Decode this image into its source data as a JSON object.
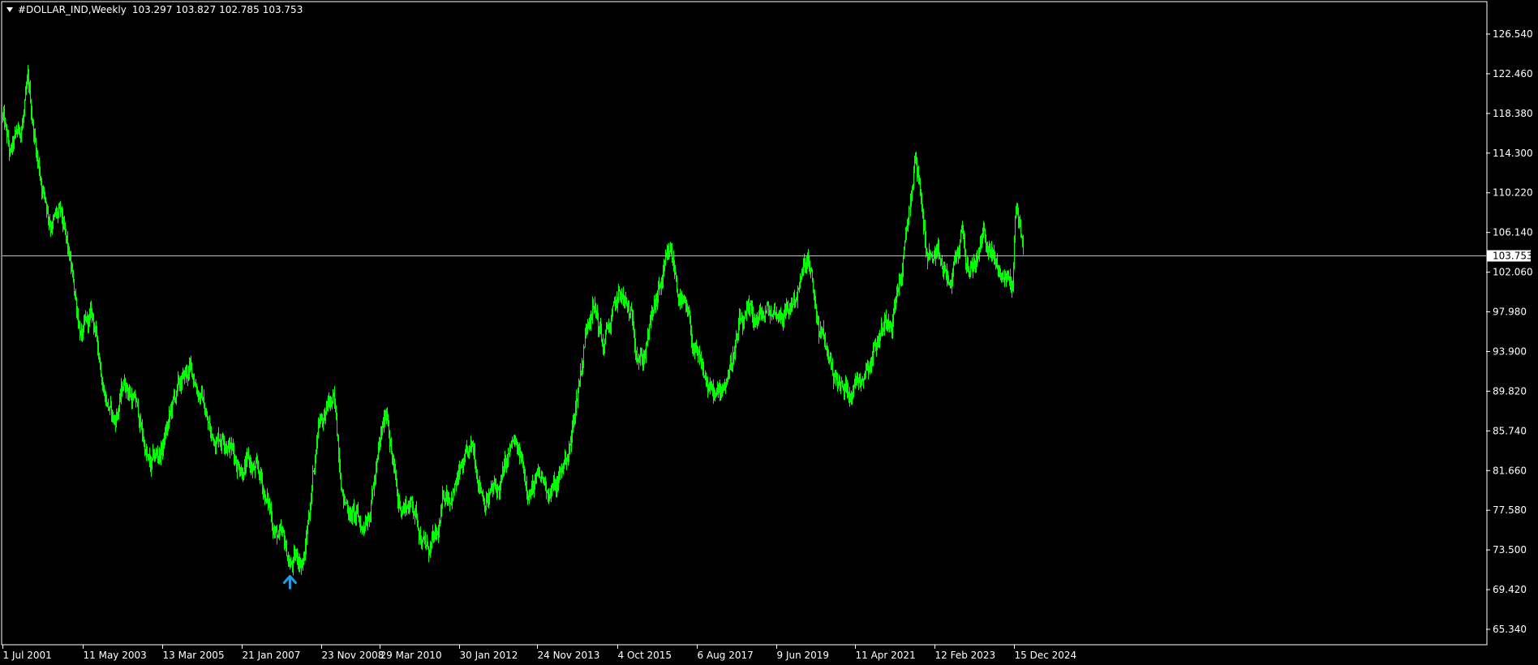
{
  "header": {
    "symbol": "#DOLLAR_IND,Weekly",
    "open": "103.297",
    "high": "103.827",
    "low": "102.785",
    "close": "103.753",
    "menu_icon": "triangle-down-icon"
  },
  "colors": {
    "background": "#000000",
    "candles": "#00ff00",
    "frame": "#ffffff",
    "axis_text": "#ffffff",
    "price_line": "#c0c0c0",
    "price_box_bg": "#ffffff",
    "price_box_text": "#000000",
    "arrow": "#1e9fe6"
  },
  "chart_data": {
    "type": "candlestick",
    "timeframe": "Weekly",
    "title": "#DOLLAR_IND,Weekly",
    "xlabel": "",
    "ylabel": "",
    "ylim": [
      63.3,
      128.6
    ],
    "grid": false,
    "x_ticks": [
      "1 Jul 2001",
      "11 May 2003",
      "13 Mar 2005",
      "21 Jan 2007",
      "23 Nov 2008",
      "29 Mar 2010",
      "30 Jan 2012",
      "24 Nov 2013",
      "4 Oct 2015",
      "6 Aug 2017",
      "9 Jun 2019",
      "11 Apr 2021",
      "12 Feb 2023",
      "15 Dec 2024"
    ],
    "y_ticks": [
      "126.540",
      "122.460",
      "118.380",
      "114.300",
      "110.220",
      "106.140",
      "102.060",
      "97.980",
      "93.900",
      "89.820",
      "85.740",
      "81.660",
      "77.580",
      "73.500",
      "69.420",
      "65.340"
    ],
    "current_price": "103.753",
    "arrow_annotation": {
      "type": "buy-arrow-up",
      "date": "2008-03"
    },
    "price_path": [
      [
        "2001-07",
        118.0
      ],
      [
        "2001-09",
        113.5
      ],
      [
        "2001-12",
        116.5
      ],
      [
        "2002-02",
        120.5
      ],
      [
        "2002-05",
        113.0
      ],
      [
        "2002-08",
        108.0
      ],
      [
        "2002-11",
        107.5
      ],
      [
        "2003-02",
        101.5
      ],
      [
        "2003-05",
        95.5
      ],
      [
        "2003-08",
        97.0
      ],
      [
        "2003-11",
        91.0
      ],
      [
        "2004-02",
        86.5
      ],
      [
        "2004-05",
        91.0
      ],
      [
        "2004-08",
        88.5
      ],
      [
        "2004-12",
        81.5
      ],
      [
        "2005-03",
        83.5
      ],
      [
        "2005-07",
        89.0
      ],
      [
        "2005-11",
        91.8
      ],
      [
        "2006-02",
        90.0
      ],
      [
        "2006-05",
        85.0
      ],
      [
        "2006-09",
        86.0
      ],
      [
        "2006-12",
        83.0
      ],
      [
        "2007-03",
        82.5
      ],
      [
        "2007-07",
        80.2
      ],
      [
        "2007-11",
        75.5
      ],
      [
        "2008-03",
        71.8
      ],
      [
        "2008-07",
        73.0
      ],
      [
        "2008-11",
        87.5
      ],
      [
        "2009-03",
        88.5
      ],
      [
        "2009-06",
        79.0
      ],
      [
        "2009-11",
        75.5
      ],
      [
        "2010-03",
        82.0
      ],
      [
        "2010-06",
        88.0
      ],
      [
        "2010-09",
        78.0
      ],
      [
        "2011-01",
        78.5
      ],
      [
        "2011-05",
        73.5
      ],
      [
        "2011-08",
        74.0
      ],
      [
        "2011-10",
        79.0
      ],
      [
        "2012-01",
        80.5
      ],
      [
        "2012-06",
        83.0
      ],
      [
        "2012-09",
        79.5
      ],
      [
        "2013-01",
        79.5
      ],
      [
        "2013-05",
        84.0
      ],
      [
        "2013-09",
        80.5
      ],
      [
        "2014-05",
        79.8
      ],
      [
        "2014-09",
        84.5
      ],
      [
        "2015-01",
        95.5
      ],
      [
        "2015-03",
        100.0
      ],
      [
        "2015-06",
        94.5
      ],
      [
        "2015-11",
        99.5
      ],
      [
        "2016-05",
        93.5
      ],
      [
        "2016-11",
        101.5
      ],
      [
        "2017-01",
        103.0
      ],
      [
        "2017-06",
        96.0
      ],
      [
        "2017-09",
        91.5
      ],
      [
        "2018-02",
        88.5
      ],
      [
        "2018-08",
        96.0
      ],
      [
        "2019-05",
        97.8
      ],
      [
        "2019-10",
        98.5
      ],
      [
        "2020-03",
        102.8
      ],
      [
        "2020-06",
        96.0
      ],
      [
        "2020-09",
        93.0
      ],
      [
        "2021-01",
        89.5
      ],
      [
        "2021-06",
        92.0
      ],
      [
        "2021-11",
        96.0
      ],
      [
        "2022-03",
        99.0
      ],
      [
        "2022-06",
        104.0
      ],
      [
        "2022-09",
        114.0
      ],
      [
        "2022-12",
        104.5
      ],
      [
        "2023-03",
        102.5
      ],
      [
        "2023-07",
        100.5
      ],
      [
        "2023-10",
        106.5
      ],
      [
        "2023-12",
        101.0
      ],
      [
        "2024-04",
        106.0
      ],
      [
        "2024-08",
        102.0
      ],
      [
        "2024-12",
        101.0
      ],
      [
        "2025-01",
        109.5
      ],
      [
        "2025-02",
        107.0
      ],
      [
        "2025-03",
        103.75
      ]
    ]
  }
}
